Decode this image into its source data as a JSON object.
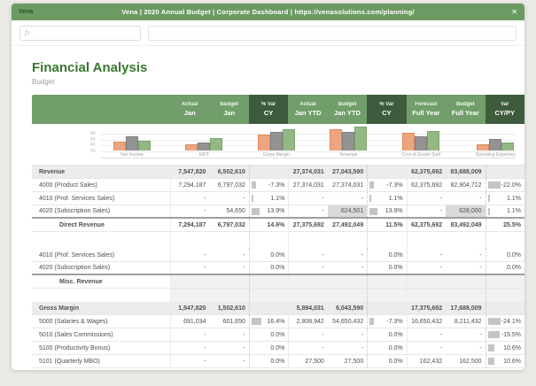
{
  "window": {
    "app_label": "Vena",
    "title": "Vena | 2020 Annual Budget | Corporate Dashboard | https://venasolutions.com/planning/",
    "close_label": "✕"
  },
  "formula_bar": {
    "fx_label": "fx",
    "input_value": ""
  },
  "page": {
    "title": "Financial Analysis",
    "subtitle": "Budget"
  },
  "colors": {
    "titlebar_green": "#6b9b63",
    "header_green": "#719e6a",
    "header_dark_green": "#3e5c3d",
    "title_green": "#38772f",
    "section_row_bg": "#ececec",
    "highlight_cell": "#d9d9d9",
    "bar_orange": "#eca57f",
    "bar_gray": "#939393",
    "bar_green": "#94b884"
  },
  "chart_data": {
    "type": "bar",
    "categories": [
      "Net Income",
      "EBIT",
      "Gross Margin",
      "Revenue",
      "Cost of Goods Sold",
      "Operating Expenses"
    ],
    "series": [
      {
        "name": "orange-series",
        "color": "#eca57f",
        "border": "#df8a60",
        "values": [
          30,
          20,
          52,
          70,
          60,
          20
        ]
      },
      {
        "name": "gray-series",
        "color": "#939393",
        "border": "#7e7e7e",
        "values": [
          48,
          27,
          62,
          63,
          47,
          38
        ]
      },
      {
        "name": "green-series",
        "color": "#94b884",
        "border": "#7aa56c",
        "values": [
          31,
          41,
          72,
          78,
          65,
          25
        ]
      }
    ],
    "title": "",
    "xlabel": "",
    "ylabel": "",
    "ylim": [
      0,
      100
    ],
    "yticks": [
      20,
      40,
      60,
      80
    ],
    "grid": true,
    "legend": "none"
  },
  "table": {
    "header": [
      {
        "top": "Actual",
        "bottom": "Jan",
        "dark": false
      },
      {
        "top": "Budget",
        "bottom": "Jan",
        "dark": false
      },
      {
        "top": "% Var",
        "bottom": "CY",
        "dark": true
      },
      {
        "top": "Actual",
        "bottom": "Jan YTD",
        "dark": false
      },
      {
        "top": "Budget",
        "bottom": "Jan YTD",
        "dark": false
      },
      {
        "top": "% Var",
        "bottom": "CY",
        "dark": true
      },
      {
        "top": "Forecast",
        "bottom": "Full Year",
        "dark": false
      },
      {
        "top": "Budget",
        "bottom": "Full Year",
        "dark": false
      },
      {
        "top": "Var",
        "bottom": "CY/PY",
        "dark": true
      }
    ],
    "rows": [
      {
        "type": "section",
        "label": "Revenue",
        "cells": [
          "7,547,820",
          "6,502,610",
          "",
          "27,374,031",
          "27,043,590",
          "",
          "62,375,692",
          "83,688,009",
          ""
        ],
        "bb": "thin"
      },
      {
        "type": "detail",
        "label": "4000 (Product Sales)",
        "cells": [
          "7,294,187",
          "6,797,032",
          "-7.3%",
          "27,374,031",
          "27,374,031",
          "-7.3%",
          "62,375,692",
          "82,904,712",
          "-22.0%"
        ],
        "bb": "thin"
      },
      {
        "type": "detail",
        "label": "4010 (Prof. Services Sales)",
        "cells": [
          "-",
          "-",
          "1.1%",
          "-",
          "-",
          "1.1%",
          "-",
          "-",
          "1.1%"
        ],
        "bb": "thin"
      },
      {
        "type": "detail",
        "label": "4020 (Subscription Sales)",
        "cells": [
          "-",
          "54,650",
          "13.9%",
          "-",
          "624,501",
          "13.9%",
          "-",
          "628,000",
          "1.1%"
        ],
        "bb": "thick",
        "hl": [
          4,
          7
        ]
      },
      {
        "type": "subtotal",
        "label": "Direct Revenue",
        "cells": [
          "7,294,187",
          "6,797,032",
          "14.6%",
          "27,375,692",
          "27,492,049",
          "11.5%",
          "62,375,692",
          "83,492,049",
          "25.5%"
        ],
        "bb": "thin"
      },
      {
        "type": "spacer1",
        "label": "",
        "cells": [
          "",
          "",
          "",
          "",
          "",
          "",
          "",
          "",
          ""
        ],
        "bb": "none"
      },
      {
        "type": "detail",
        "label": "4010 (Prof. Services Sales)",
        "cells": [
          "-",
          "-",
          "0.0%",
          "-",
          "-",
          "0.0%",
          "-",
          "-",
          "0.0%"
        ],
        "bb": "thin"
      },
      {
        "type": "detail",
        "label": "4020 (Subscription Sales)",
        "cells": [
          "-",
          "-",
          "0.0%",
          "-",
          "-",
          "0.0%",
          "-",
          "-",
          "0.0%"
        ],
        "bb": "thick"
      },
      {
        "type": "subtotal",
        "label": "Misc. Revenue",
        "cells": [
          "",
          "",
          "",
          "",
          "",
          "",
          "",
          "",
          ""
        ],
        "bb": "thin",
        "tint": true
      },
      {
        "type": "spacer2",
        "label": "",
        "cells": [
          "",
          "",
          "",
          "",
          "",
          "",
          "",
          "",
          ""
        ],
        "bb": "none",
        "tint": true
      },
      {
        "type": "section",
        "label": "Gross Margin",
        "cells": [
          "1,547,820",
          "1,502,610",
          "",
          "5,894,031",
          "6,043,590",
          "",
          "17,375,692",
          "17,688,009",
          ""
        ],
        "bb": "thin"
      },
      {
        "type": "detail",
        "label": "5000 (Salaries & Wages)",
        "cells": [
          "691,034",
          "601,650",
          "16.4%",
          "2,808,942",
          "54,650,432",
          "-7.3%",
          "16,650,432",
          "8,211,432",
          "-24.1%"
        ],
        "bb": "thin"
      },
      {
        "type": "detail",
        "label": "5010 (Sales Commissions)",
        "cells": [
          "-",
          "-",
          "0.0%",
          "-",
          "-",
          "0.0%",
          "-",
          "-",
          "-19.5%"
        ],
        "bb": "thin"
      },
      {
        "type": "detail",
        "label": "5100 (Productivity Bonus)",
        "cells": [
          "-",
          "-",
          "0.0%",
          "-",
          "-",
          "0.0%",
          "-",
          "-",
          "10.6%"
        ],
        "bb": "thin"
      },
      {
        "type": "detail",
        "label": "5101 (Quarterly MBO)",
        "cells": [
          "-",
          "-",
          "0.0%",
          "27,500",
          "27,500",
          "0.0%",
          "162,432",
          "162,500",
          "10.6%"
        ],
        "bb": "thin"
      }
    ]
  }
}
